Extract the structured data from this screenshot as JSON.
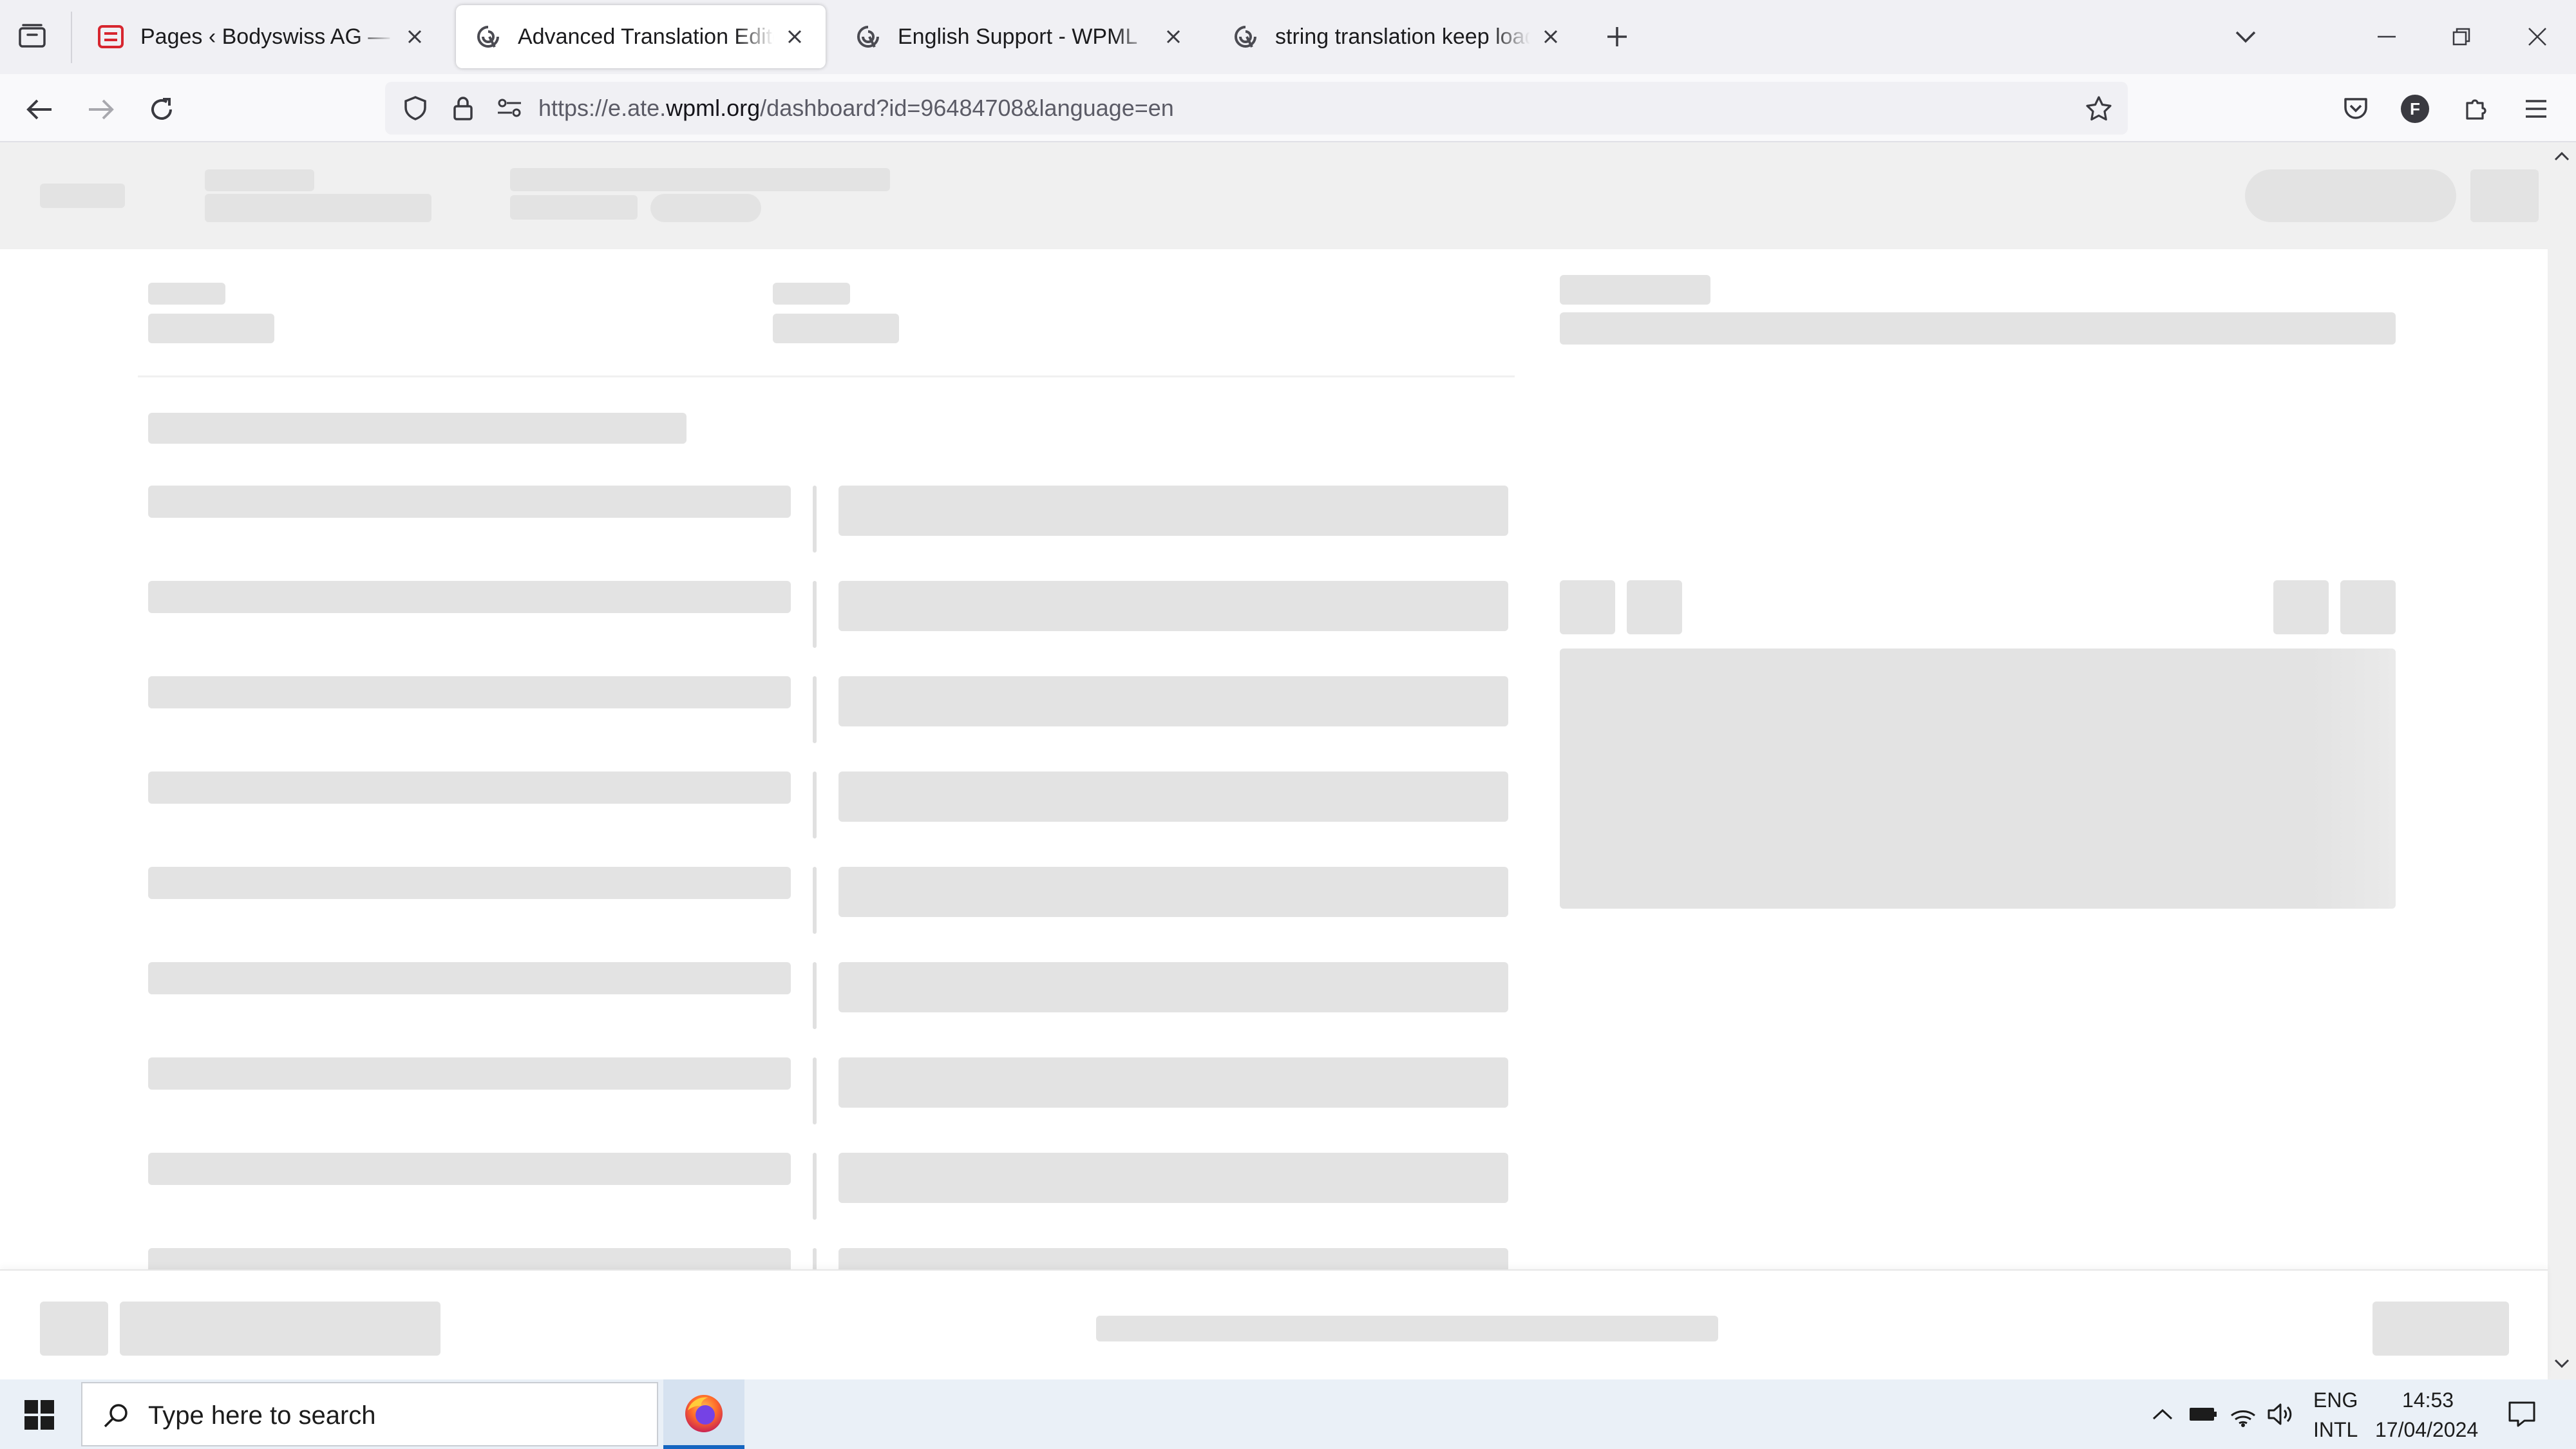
{
  "browser": {
    "tabs": [
      {
        "title": "Pages ‹ Bodyswiss AG — WordPress",
        "icon": "wordpress-site-icon",
        "active": false
      },
      {
        "title": "Advanced Translation Editor - WPML",
        "icon": "wpml-icon",
        "active": true
      },
      {
        "title": "English Support - WPML",
        "icon": "wpml-icon",
        "active": false
      },
      {
        "title": "string translation keep loading",
        "icon": "wpml-icon",
        "active": false
      }
    ],
    "url_prefix": "https://e.ate.",
    "url_host": "wpml.org",
    "url_path": "/dashboard?id=96484708&language=en",
    "profile_initial": "F"
  },
  "taskbar": {
    "search_placeholder": "Type here to search",
    "lang_primary": "ENG",
    "lang_secondary": "INTL",
    "time": "14:53",
    "date": "17/04/2024"
  },
  "colors": {
    "skeleton": "#e3e3e3",
    "page_header": "#f0f0f0",
    "tab_strip": "#f0f0f4",
    "taskbar": "#eaf0f7",
    "firefox_active_underline": "#1565c0"
  }
}
